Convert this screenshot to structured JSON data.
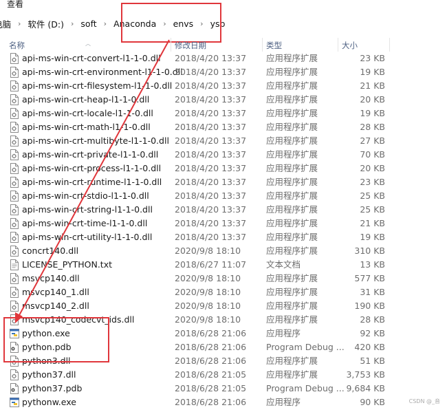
{
  "ribbon": {
    "view_tab": "查看"
  },
  "address_bar": {
    "crumbs": [
      "电脑",
      "软件 (D:)",
      "soft",
      "Anaconda",
      "envs",
      "ysp"
    ]
  },
  "columns": {
    "name": "名称",
    "modified": "修改日期",
    "type": "类型",
    "size": "大小"
  },
  "files": [
    {
      "name": "api-ms-win-crt-convert-l1-1-0.dll",
      "date": "2018/4/20 13:37",
      "type": "应用程序扩展",
      "size": "23 KB",
      "icon": "dll-file-icon"
    },
    {
      "name": "api-ms-win-crt-environment-l1-1-0.dll",
      "date": "2018/4/20 13:37",
      "type": "应用程序扩展",
      "size": "19 KB",
      "icon": "dll-file-icon"
    },
    {
      "name": "api-ms-win-crt-filesystem-l1-1-0.dll",
      "date": "2018/4/20 13:37",
      "type": "应用程序扩展",
      "size": "21 KB",
      "icon": "dll-file-icon"
    },
    {
      "name": "api-ms-win-crt-heap-l1-1-0.dll",
      "date": "2018/4/20 13:37",
      "type": "应用程序扩展",
      "size": "20 KB",
      "icon": "dll-file-icon"
    },
    {
      "name": "api-ms-win-crt-locale-l1-1-0.dll",
      "date": "2018/4/20 13:37",
      "type": "应用程序扩展",
      "size": "19 KB",
      "icon": "dll-file-icon"
    },
    {
      "name": "api-ms-win-crt-math-l1-1-0.dll",
      "date": "2018/4/20 13:37",
      "type": "应用程序扩展",
      "size": "28 KB",
      "icon": "dll-file-icon"
    },
    {
      "name": "api-ms-win-crt-multibyte-l1-1-0.dll",
      "date": "2018/4/20 13:37",
      "type": "应用程序扩展",
      "size": "27 KB",
      "icon": "dll-file-icon"
    },
    {
      "name": "api-ms-win-crt-private-l1-1-0.dll",
      "date": "2018/4/20 13:37",
      "type": "应用程序扩展",
      "size": "70 KB",
      "icon": "dll-file-icon"
    },
    {
      "name": "api-ms-win-crt-process-l1-1-0.dll",
      "date": "2018/4/20 13:37",
      "type": "应用程序扩展",
      "size": "20 KB",
      "icon": "dll-file-icon"
    },
    {
      "name": "api-ms-win-crt-runtime-l1-1-0.dll",
      "date": "2018/4/20 13:37",
      "type": "应用程序扩展",
      "size": "23 KB",
      "icon": "dll-file-icon"
    },
    {
      "name": "api-ms-win-crt-stdio-l1-1-0.dll",
      "date": "2018/4/20 13:37",
      "type": "应用程序扩展",
      "size": "25 KB",
      "icon": "dll-file-icon"
    },
    {
      "name": "api-ms-win-crt-string-l1-1-0.dll",
      "date": "2018/4/20 13:37",
      "type": "应用程序扩展",
      "size": "25 KB",
      "icon": "dll-file-icon"
    },
    {
      "name": "api-ms-win-crt-time-l1-1-0.dll",
      "date": "2018/4/20 13:37",
      "type": "应用程序扩展",
      "size": "21 KB",
      "icon": "dll-file-icon"
    },
    {
      "name": "api-ms-win-crt-utility-l1-1-0.dll",
      "date": "2018/4/20 13:37",
      "type": "应用程序扩展",
      "size": "19 KB",
      "icon": "dll-file-icon"
    },
    {
      "name": "concrt140.dll",
      "date": "2020/9/8 18:10",
      "type": "应用程序扩展",
      "size": "310 KB",
      "icon": "dll-file-icon"
    },
    {
      "name": "LICENSE_PYTHON.txt",
      "date": "2018/6/27 11:07",
      "type": "文本文档",
      "size": "13 KB",
      "icon": "text-file-icon"
    },
    {
      "name": "msvcp140.dll",
      "date": "2020/9/8 18:10",
      "type": "应用程序扩展",
      "size": "577 KB",
      "icon": "dll-file-icon"
    },
    {
      "name": "msvcp140_1.dll",
      "date": "2020/9/8 18:10",
      "type": "应用程序扩展",
      "size": "31 KB",
      "icon": "dll-file-icon"
    },
    {
      "name": "msvcp140_2.dll",
      "date": "2020/9/8 18:10",
      "type": "应用程序扩展",
      "size": "190 KB",
      "icon": "dll-file-icon"
    },
    {
      "name": "msvcp140_codecvt_ids.dll",
      "date": "2020/9/8 18:10",
      "type": "应用程序扩展",
      "size": "28 KB",
      "icon": "dll-file-icon"
    },
    {
      "name": "python.exe",
      "date": "2018/6/28 21:06",
      "type": "应用程序",
      "size": "92 KB",
      "icon": "python-exe-icon"
    },
    {
      "name": "python.pdb",
      "date": "2018/6/28 21:06",
      "type": "Program Debug ...",
      "size": "420 KB",
      "icon": "pdb-file-icon"
    },
    {
      "name": "python3.dll",
      "date": "2018/6/28 21:06",
      "type": "应用程序扩展",
      "size": "51 KB",
      "icon": "dll-file-icon"
    },
    {
      "name": "python37.dll",
      "date": "2018/6/28 21:05",
      "type": "应用程序扩展",
      "size": "3,753 KB",
      "icon": "dll-file-icon"
    },
    {
      "name": "python37.pdb",
      "date": "2018/6/28 21:05",
      "type": "Program Debug ...",
      "size": "9,684 KB",
      "icon": "pdb-file-icon"
    },
    {
      "name": "pythonw.exe",
      "date": "2018/6/28 21:06",
      "type": "应用程序",
      "size": "90 KB",
      "icon": "python-exe-icon"
    }
  ],
  "watermark": "CSDN @_音",
  "colors": {
    "annotation": "#e0363b",
    "header_text": "#4d6082"
  }
}
